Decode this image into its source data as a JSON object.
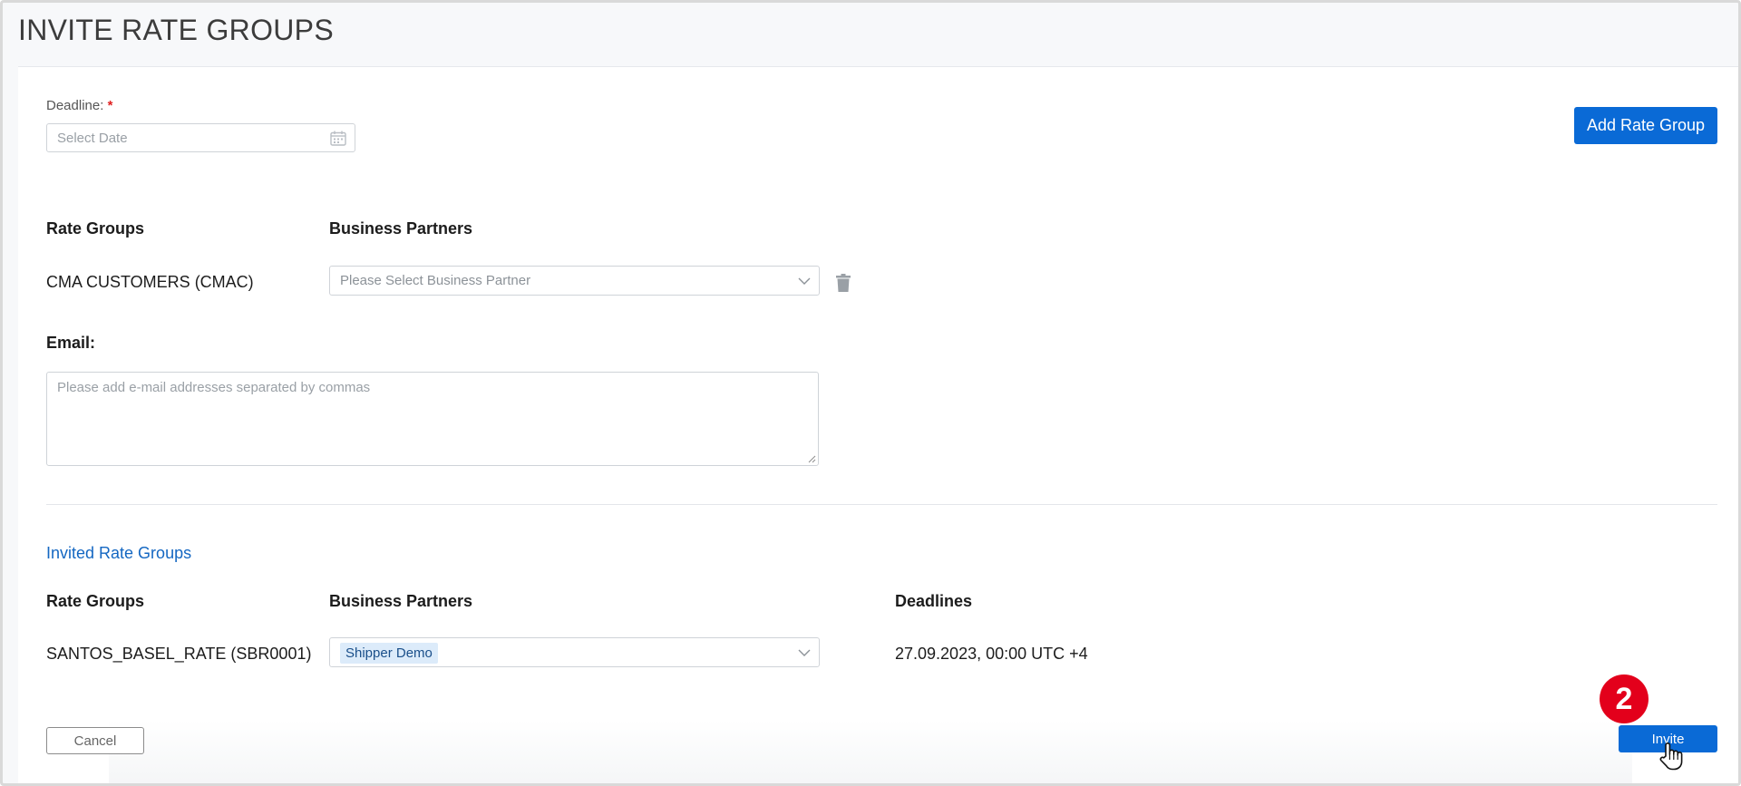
{
  "page": {
    "title": "INVITE RATE GROUPS"
  },
  "deadline": {
    "label": "Deadline:",
    "required_mark": "*",
    "placeholder": "Select Date",
    "icon": "calendar-icon"
  },
  "toolbar": {
    "add_rate_group_label": "Add Rate Group"
  },
  "rate_groups_section": {
    "col_rate_groups": "Rate Groups",
    "col_business_partners": "Business Partners",
    "row": {
      "rate_group": "CMA CUSTOMERS (CMAC)",
      "partner_placeholder": "Please Select Business Partner",
      "delete_icon": "trash-icon"
    }
  },
  "email": {
    "label": "Email:",
    "placeholder": "Please add e-mail addresses separated by commas"
  },
  "invited_section": {
    "title": "Invited Rate Groups",
    "col_rate_groups": "Rate Groups",
    "col_business_partners": "Business Partners",
    "col_deadlines": "Deadlines",
    "row": {
      "rate_group": "SANTOS_BASEL_RATE (SBR0001)",
      "partner_tag": "Shipper Demo",
      "deadline": "27.09.2023, 00:00 UTC +4"
    }
  },
  "footer": {
    "cancel_label": "Cancel",
    "invite_label": "Invite"
  },
  "annotation": {
    "step_number": "2"
  },
  "colors": {
    "primary": "#0a6ad6",
    "link": "#1467c2",
    "badge": "#e3001b",
    "required": "#e02020"
  }
}
